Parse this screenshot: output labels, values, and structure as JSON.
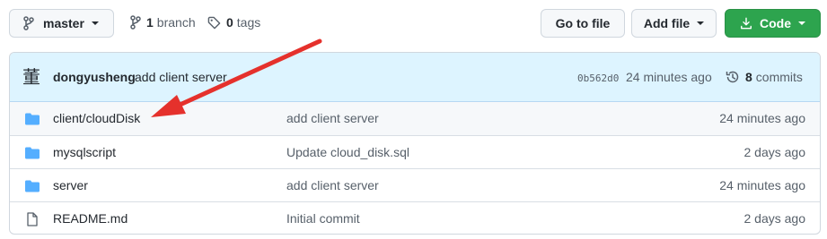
{
  "branch_selector": {
    "label": "master",
    "icon": "git-branch-icon"
  },
  "branches": {
    "count": "1",
    "label": "branch",
    "icon": "git-branch-icon"
  },
  "tags": {
    "count": "0",
    "label": "tags",
    "icon": "tag-icon"
  },
  "actions": {
    "go_to_file": "Go to file",
    "add_file": "Add file",
    "code": "Code",
    "code_icon": "download-icon"
  },
  "latest_commit": {
    "avatar_glyph": "董",
    "author": "dongyusheng",
    "message": "add client server",
    "sha": "0b562d0",
    "age": "24 minutes ago",
    "commits_count": "8",
    "commits_label": "commits",
    "history_icon": "history-icon"
  },
  "files": [
    {
      "type": "folder",
      "name_prefix": "client/",
      "name": "cloudDisk",
      "message": "add client server",
      "age": "24 minutes ago"
    },
    {
      "type": "folder",
      "name_prefix": "",
      "name": "mysqlscript",
      "message": "Update cloud_disk.sql",
      "age": "2 days ago"
    },
    {
      "type": "folder",
      "name_prefix": "",
      "name": "server",
      "message": "add client server",
      "age": "24 minutes ago"
    },
    {
      "type": "file",
      "name_prefix": "",
      "name": "README.md",
      "message": "Initial commit",
      "age": "2 days ago"
    }
  ],
  "colors": {
    "accent_green": "#2da44e",
    "folder_blue": "#54aeff",
    "annotation_red": "#e5312c",
    "header_bg": "#ddf4ff"
  }
}
